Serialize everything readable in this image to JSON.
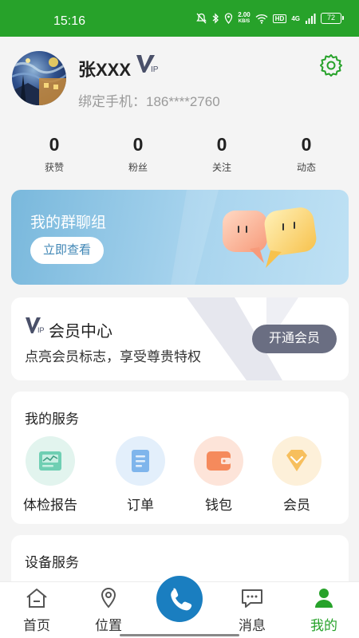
{
  "status_bar": {
    "time": "15:16",
    "net_speed_value": "2.00",
    "net_speed_unit": "KB/S",
    "hd": "HD",
    "signal": "4G",
    "battery": "72"
  },
  "profile": {
    "name": "张XXX",
    "phone": "绑定手机：186****2760"
  },
  "stats": [
    {
      "count": "0",
      "label": "获赞"
    },
    {
      "count": "0",
      "label": "粉丝"
    },
    {
      "count": "0",
      "label": "关注"
    },
    {
      "count": "0",
      "label": "动态"
    }
  ],
  "group_banner": {
    "title": "我的群聊组",
    "button": "立即查看"
  },
  "vip_card": {
    "title": "会员中心",
    "subtitle": "点亮会员标志，享受尊贵特权",
    "button": "开通会员"
  },
  "services": {
    "title": "我的服务",
    "items": [
      {
        "label": "体检报告",
        "icon": "report-icon",
        "color": "#6fcfb3"
      },
      {
        "label": "订单",
        "icon": "order-icon",
        "color": "#7fb5ec"
      },
      {
        "label": "钱包",
        "icon": "wallet-icon",
        "color": "#f58a5c"
      },
      {
        "label": "会员",
        "icon": "diamond-icon",
        "color": "#f7bf5d"
      }
    ]
  },
  "device": {
    "title": "设备服务"
  },
  "tabbar": {
    "items": [
      {
        "label": "首页",
        "icon": "home-icon"
      },
      {
        "label": "位置",
        "icon": "location-icon"
      },
      {
        "label": "",
        "icon": "phone-icon"
      },
      {
        "label": "消息",
        "icon": "message-icon"
      },
      {
        "label": "我的",
        "icon": "user-icon"
      }
    ],
    "active": "我的"
  },
  "colors": {
    "brand": "#27a22a",
    "call_button": "#1a7ec0",
    "vip_button": "#6a6e82"
  }
}
